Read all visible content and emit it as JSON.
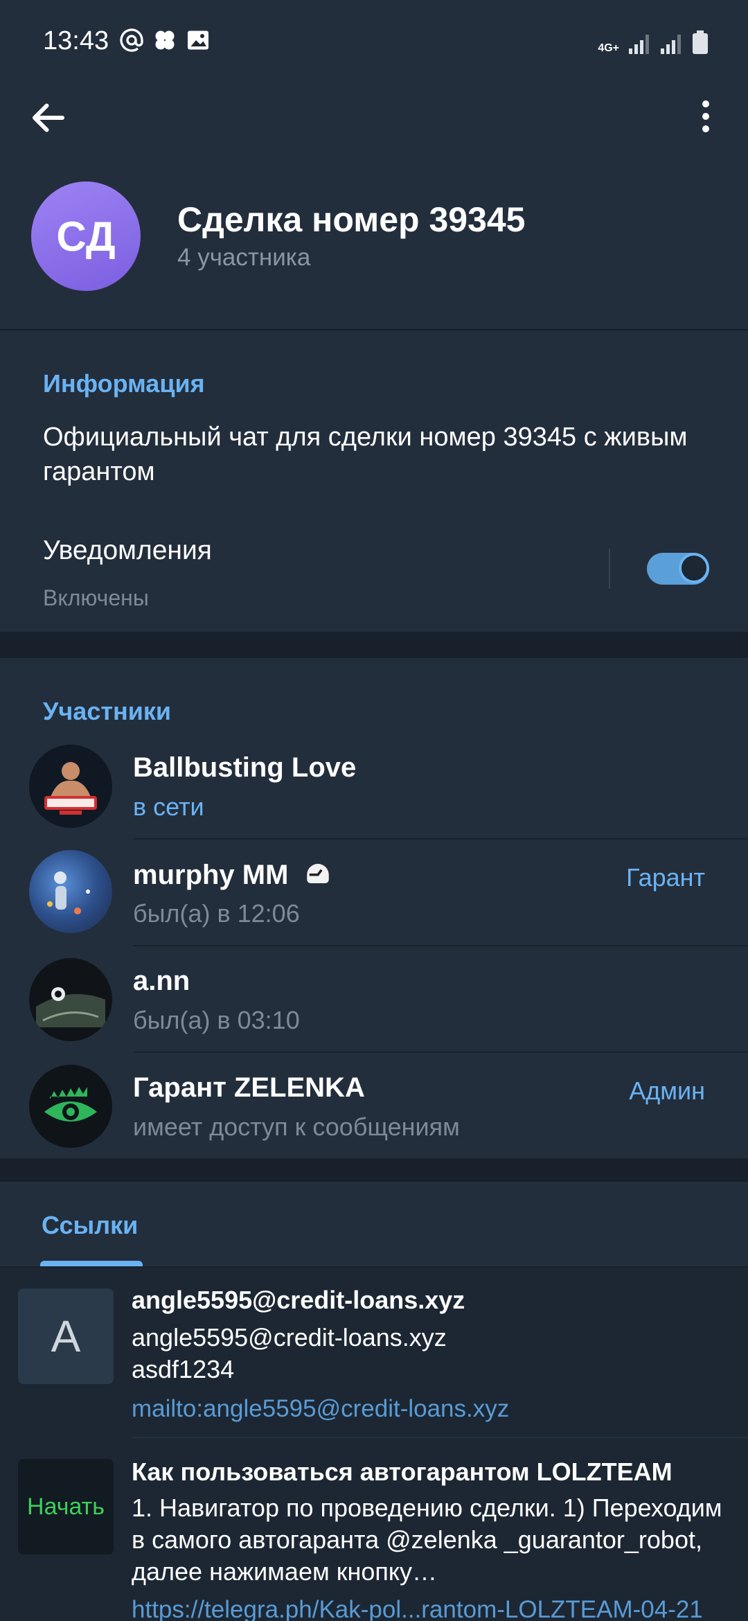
{
  "status_bar": {
    "time": "13:43",
    "left_icons": [
      "at-icon",
      "clover-icon",
      "image-icon"
    ],
    "network": "4G+"
  },
  "header": {
    "avatar_initials": "СД",
    "title": "Сделка номер 39345",
    "subtitle": "4 участника"
  },
  "info": {
    "section_title": "Информация",
    "description": "Официальный чат для сделки номер 39345 с живым гарантом",
    "notifications_label": "Уведомления",
    "notifications_status": "Включены",
    "notifications_on": true
  },
  "members": {
    "section_title": "Участники",
    "items": [
      {
        "name": "Ballbusting Love",
        "status": "в сети",
        "role": ""
      },
      {
        "name": "murphy MM",
        "status": "был(а) в 12:06",
        "role": "Гарант"
      },
      {
        "name": "a.nn",
        "status": "был(а) в 03:10",
        "role": ""
      },
      {
        "name": "Гарант ZELENKA",
        "status": "имеет доступ к сообщениям",
        "role": "Админ"
      }
    ]
  },
  "links": {
    "tab_label": "Ссылки",
    "items": [
      {
        "thumb_letter": "A",
        "title": "angle5595@credit-loans.xyz",
        "line1": "angle5595@credit-loans.xyz",
        "line2": "asdf1234",
        "url": "mailto:angle5595@credit-loans.xyz"
      },
      {
        "thumb_text": "Начать",
        "title": "Как пользоваться автогарантом LOLZTEAM",
        "body": "1. Навигатор по проведению сделки. 1) Переходим в самого автогаранта @zelenka _guarantor_robot, далее нажимаем кнопку…",
        "url": "https://telegra.ph/Kak-pol...rantom-LOLZTEAM-04-21"
      }
    ]
  },
  "colors": {
    "accent": "#6ab3f3",
    "background": "#1c2733",
    "surface": "#232e3c"
  }
}
